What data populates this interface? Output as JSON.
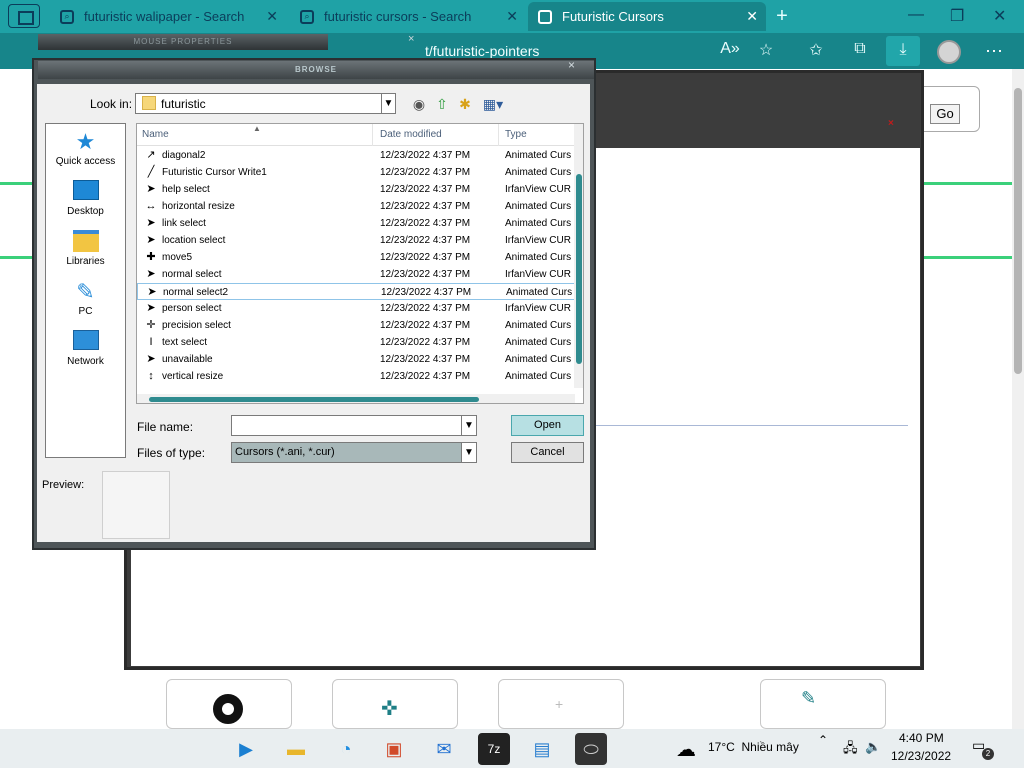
{
  "browser": {
    "tabs": [
      {
        "label": "futuristic walipaper - Search",
        "active": false
      },
      {
        "label": "futuristic cursors - Search",
        "active": false
      },
      {
        "label": "Futuristic Cursors",
        "active": true
      }
    ],
    "address_fragment": "t/futuristic-pointers",
    "icons": [
      "sidebar-icon",
      "search-icon",
      "close-icon",
      "new-tab-icon",
      "minimize-icon",
      "maximize-icon",
      "close-window-icon",
      "read-aloud-icon",
      "favorite-icon",
      "favorites-icon",
      "collections-icon",
      "download-icon",
      "profile-icon",
      "more-icon"
    ]
  },
  "page": {
    "go_label": "Go",
    "red_x": "×"
  },
  "mouse_properties": {
    "title": "MOUSE PROPERTIES",
    "close": "×"
  },
  "browse_dialog": {
    "title": "BROWSE",
    "close": "×",
    "look_in_label": "Look in:",
    "look_in_value": "futuristic",
    "places": [
      {
        "label": "Quick access",
        "icon": "star-icon"
      },
      {
        "label": "Desktop",
        "icon": "desktop-icon"
      },
      {
        "label": "Libraries",
        "icon": "libraries-icon"
      },
      {
        "label": "PC",
        "icon": "pc-icon"
      },
      {
        "label": "Network",
        "icon": "network-icon"
      }
    ],
    "columns": {
      "name": "Name",
      "date": "Date modified",
      "type": "Type"
    },
    "files": [
      {
        "name": "diagonal2",
        "date": "12/23/2022 4:37 PM",
        "type": "Animated Curs",
        "icon": "↗"
      },
      {
        "name": "Futuristic Cursor Write1",
        "date": "12/23/2022 4:37 PM",
        "type": "Animated Curs",
        "icon": "╱"
      },
      {
        "name": "help select",
        "date": "12/23/2022 4:37 PM",
        "type": "IrfanView CUR",
        "icon": "➤"
      },
      {
        "name": "horizontal resize",
        "date": "12/23/2022 4:37 PM",
        "type": "Animated Curs",
        "icon": "↔"
      },
      {
        "name": "link select",
        "date": "12/23/2022 4:37 PM",
        "type": "Animated Curs",
        "icon": "➤"
      },
      {
        "name": "location select",
        "date": "12/23/2022 4:37 PM",
        "type": "IrfanView CUR",
        "icon": "➤"
      },
      {
        "name": "move5",
        "date": "12/23/2022 4:37 PM",
        "type": "Animated Curs",
        "icon": "✚"
      },
      {
        "name": "normal select",
        "date": "12/23/2022 4:37 PM",
        "type": "IrfanView CUR",
        "icon": "➤"
      },
      {
        "name": "normal select2",
        "date": "12/23/2022 4:37 PM",
        "type": "Animated Curs",
        "icon": "➤"
      },
      {
        "name": "person select",
        "date": "12/23/2022 4:37 PM",
        "type": "IrfanView CUR",
        "icon": "➤"
      },
      {
        "name": "precision select",
        "date": "12/23/2022 4:37 PM",
        "type": "Animated Curs",
        "icon": "✛"
      },
      {
        "name": "text select",
        "date": "12/23/2022 4:37 PM",
        "type": "Animated Curs",
        "icon": "Ι"
      },
      {
        "name": "unavailable",
        "date": "12/23/2022 4:37 PM",
        "type": "Animated Curs",
        "icon": "➤"
      },
      {
        "name": "vertical resize",
        "date": "12/23/2022 4:37 PM",
        "type": "Animated Curs",
        "icon": "↕"
      }
    ],
    "selected_file": "normal select2",
    "file_name_label": "File name:",
    "file_name_value": "",
    "files_of_type_label": "Files of type:",
    "files_of_type_value": "Cursors (*.ani, *.cur)",
    "open_label": "Open",
    "cancel_label": "Cancel",
    "preview_label": "Preview:"
  },
  "taskbar": {
    "apps": [
      "media-player-icon",
      "file-explorer-icon",
      "edge-icon",
      "store-icon",
      "mail-icon",
      "7zip-icon",
      "control-panel-icon",
      "mouse-icon"
    ],
    "weather_temp": "17°C",
    "weather_text": "Nhiều mây",
    "time": "4:40 PM",
    "date": "12/23/2022",
    "notification_count": "2"
  },
  "colors": {
    "accent": "#1fa2a6",
    "address_bar": "#17858a",
    "dialog_frame": "#4e5558",
    "scroll_thumb": "#2f8b8f"
  }
}
